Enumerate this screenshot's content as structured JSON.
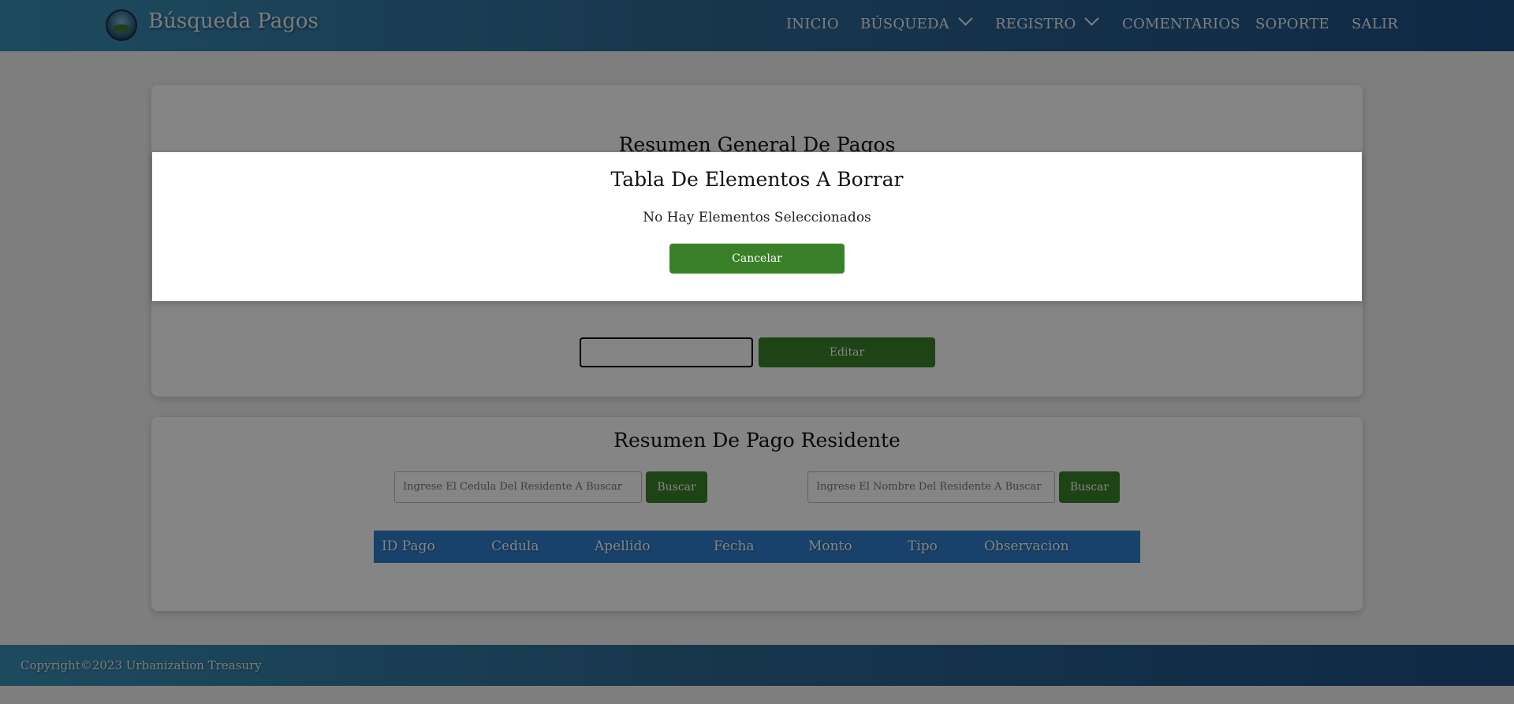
{
  "header": {
    "brand": "Búsqueda Pagos",
    "nav": [
      {
        "label": "INICIO"
      },
      {
        "label": "BÚSQUEDA",
        "dropdown": true
      },
      {
        "label": "REGISTRO",
        "dropdown": true
      },
      {
        "label": "COMENTARIOS"
      },
      {
        "label": "SOPORTE"
      },
      {
        "label": "SALIR"
      }
    ]
  },
  "general_summary": {
    "title": "Resumen General De Pagos",
    "input_value": "",
    "edit_label": "Editar"
  },
  "resident_summary": {
    "title": "Resumen De Pago Residente",
    "cedula_placeholder": "Ingrese El Cedula Del Residente A Buscar",
    "nombre_placeholder": "Ingrese El Nombre Del Residente A Buscar",
    "search_label": "Buscar",
    "columns": [
      "ID Pago",
      "Cedula",
      "Apellido",
      "Fecha",
      "Monto",
      "Tipo",
      "Observacion"
    ],
    "rows": []
  },
  "footer": {
    "copyright": "Copyright©2023 Urbanization Treasury"
  },
  "modal": {
    "title": "Tabla De Elementos A Borrar",
    "message": "No Hay Elementos Seleccionados",
    "cancel_label": "Cancelar"
  },
  "colors": {
    "header_gradient_start": "#3a8fb5",
    "header_gradient_end": "#1f4f85",
    "button_green": "#3a8028",
    "table_header_blue": "#2f7fcd",
    "overlay": "rgba(0,0,0,0.48)"
  }
}
